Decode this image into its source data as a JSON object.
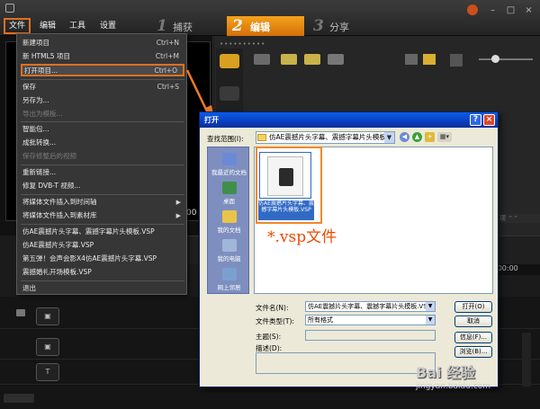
{
  "menubar": {
    "items": [
      "文件",
      "编辑",
      "工具",
      "设置"
    ],
    "steps": [
      {
        "num": "1",
        "label": "捕获"
      },
      {
        "num": "2",
        "label": "编辑"
      },
      {
        "num": "3",
        "label": "分享"
      }
    ]
  },
  "file_menu": {
    "items": [
      {
        "label": "新建项目",
        "shortcut": "Ctrl+N",
        "disabled": false
      },
      {
        "label": "新 HTML5 项目",
        "shortcut": "Ctrl+M",
        "disabled": false
      },
      {
        "label": "打开项目...",
        "shortcut": "Ctrl+O",
        "disabled": false
      },
      {
        "label": "保存",
        "shortcut": "Ctrl+S",
        "disabled": false
      },
      {
        "label": "另存为...",
        "shortcut": "",
        "disabled": false
      },
      {
        "label": "导出为模板...",
        "shortcut": "",
        "disabled": true
      },
      {
        "label": "智能包...",
        "shortcut": "",
        "disabled": false
      },
      {
        "label": "成批转换...",
        "shortcut": "",
        "disabled": false
      },
      {
        "label": "保存修整后的视频",
        "shortcut": "",
        "disabled": true
      },
      {
        "label": "重新链接...",
        "shortcut": "",
        "disabled": false
      },
      {
        "label": "修复 DVB-T 视频...",
        "shortcut": "",
        "disabled": false
      },
      {
        "label": "将媒体文件插入到时间轴",
        "shortcut": "",
        "disabled": false
      },
      {
        "label": "将媒体文件插入到素材库",
        "shortcut": "",
        "disabled": false
      },
      {
        "label": "仿AE震撼片头字幕、震撼字幕片头模板.VSP",
        "shortcut": "",
        "disabled": false
      },
      {
        "label": "仿AE震撼片头字幕.VSP",
        "shortcut": "",
        "disabled": false
      },
      {
        "label": "第五弹！会声会影X4仿AE震撼片头字幕.VSP",
        "shortcut": "",
        "disabled": false
      },
      {
        "label": "震撼婚礼开场模板.VSP",
        "shortcut": "",
        "disabled": false
      },
      {
        "label": "退出",
        "shortcut": "",
        "disabled": false
      }
    ]
  },
  "dialog": {
    "title": "打开",
    "look_in_label": "查找范围(I):",
    "look_in_value": "仿AE震撼片头字幕、震撼字幕片头模板",
    "places": [
      "我最近的文档",
      "桌面",
      "我的文档",
      "我的电脑",
      "网上邻居"
    ],
    "file_caption": "仿AE震撼片头字幕、震撼字幕片头模板.VSP",
    "filename_label": "文件名(N):",
    "filename_value": "仿AE震撼片头字幕、震撼字幕片头模板.VSP",
    "filetype_label": "文件类型(T):",
    "filetype_value": "所有格式",
    "subject_label": "主题(S):",
    "desc_label": "描述(D):",
    "btn_open": "打开(O)",
    "btn_cancel": "取消",
    "btn_info": "信息(F)...",
    "btn_browse": "浏览(B)..."
  },
  "annotation": "*.vsp文件",
  "watermark": {
    "logo": "Bai 经验",
    "url": "jingyan.baidu.com"
  },
  "colors": {
    "highlight_orange": "#e0701e",
    "step_active": "#f2951a",
    "dialog_title": "#0a4fd6"
  }
}
